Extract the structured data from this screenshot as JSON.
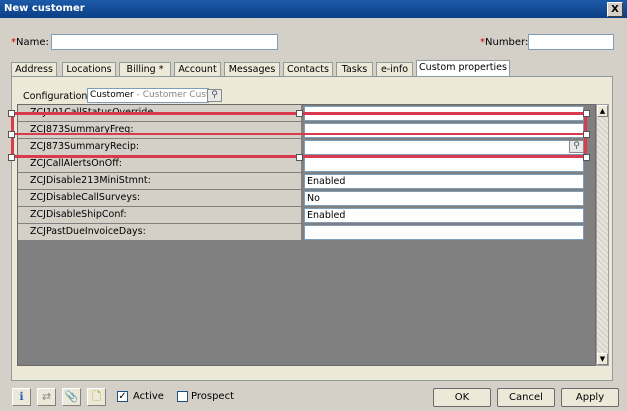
{
  "window": {
    "title": "New customer",
    "close_glyph": "X"
  },
  "header": {
    "name_label": "Name:",
    "name_value": "",
    "number_label": "Number:",
    "number_value": "",
    "required_marker": "*"
  },
  "tabs": [
    {
      "label": "Address",
      "active": false
    },
    {
      "label": "Locations",
      "active": false
    },
    {
      "label": "Billing *",
      "active": false
    },
    {
      "label": "Account",
      "active": false
    },
    {
      "label": "Messages",
      "active": false
    },
    {
      "label": "Contacts",
      "active": false
    },
    {
      "label": "Tasks",
      "active": false
    },
    {
      "label": "e-info",
      "active": false
    },
    {
      "label": "Custom properties",
      "active": true
    }
  ],
  "configuration": {
    "label": "Configuration:",
    "value": "Customer",
    "value_suffix": "- Customer Custom"
  },
  "properties": [
    {
      "name": "ZCJ101CallStatusOverride",
      "value": ""
    },
    {
      "name": "ZCJ873SummaryFreq:",
      "value": ""
    },
    {
      "name": "ZCJ873SummaryRecip:",
      "value": ""
    },
    {
      "name": "ZCJCallAlertsOnOff:",
      "value": ""
    },
    {
      "name": "ZCJDisable213MiniStmnt:",
      "value": "Enabled"
    },
    {
      "name": "ZCJDisableCallSurveys:",
      "value": "No"
    },
    {
      "name": "ZCJDisableShipConf:",
      "value": "Enabled"
    },
    {
      "name": "ZCJPastDueInvoiceDays:",
      "value": ""
    }
  ],
  "footer": {
    "icons": [
      "info-icon",
      "transfer-icon",
      "attach-icon",
      "notes-icon"
    ],
    "active_label": "Active",
    "active_checked": true,
    "prospect_label": "Prospect",
    "prospect_checked": false,
    "ok_label": "OK",
    "cancel_label": "Cancel",
    "apply_label": "Apply"
  },
  "colors": {
    "title_bar": "#0a3f85",
    "required": "#cc0000",
    "selection_frame": "#d93a4e"
  }
}
